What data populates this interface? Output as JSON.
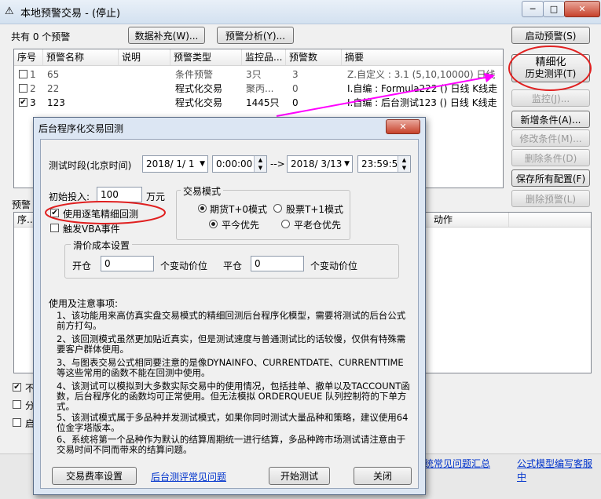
{
  "window": {
    "title": "本地预警交易 - (停止)",
    "caption_min": "─",
    "caption_max": "□",
    "caption_close": "✕"
  },
  "toolbar": {
    "count_label": "共有 0 个预警",
    "data_supplement": "数据补充(W)...",
    "alert_analysis": "预警分析(Y)...",
    "start_alert": "启动预警(S)"
  },
  "table": {
    "headers": [
      "序号",
      "预警名称",
      "说明",
      "预警类型",
      "监控品...",
      "预警数",
      "摘要"
    ],
    "rows": [
      {
        "checked": false,
        "no": "1",
        "name": "65",
        "desc": "",
        "type": "条件预警",
        "monitor": "3只",
        "count": "3",
        "summary": "Z.自定义 : 3.1 (5,10,10000) 日线"
      },
      {
        "checked": false,
        "no": "2",
        "name": "22",
        "desc": "",
        "type": "程式化交易",
        "monitor": "聚丙...",
        "count": "0",
        "summary": "I.自编 : Formula222 () 日线 K线走"
      },
      {
        "checked": true,
        "no": "3",
        "name": "123",
        "desc": "",
        "type": "程式化交易",
        "monitor": "1445只",
        "count": "0",
        "summary": "I.自编 : 后台测试123 () 日线 K线走"
      }
    ]
  },
  "side_buttons": {
    "fine_backtest_line1": "精细化",
    "fine_backtest_line2": "历史测评(T)",
    "monitor": "监控(J)...",
    "add_condition": "新增条件(A)...",
    "modify_condition": "修改条件(M)...",
    "delete_condition": "删除条件(D)",
    "save_all": "保存所有配置(F)",
    "delete_alert": "删除预警(L)"
  },
  "lower": {
    "panel_label": "预警",
    "col_seq": "序...",
    "col_action": "动作",
    "chk1_label": "不",
    "chk2_label": "分",
    "chk3_label": "启"
  },
  "bottom_links": {
    "faq": "统常见问题汇总",
    "formula_service": "公式模型编写客服中"
  },
  "dialog": {
    "title": "后台程序化交易回测",
    "close": "✕",
    "period_label": "测试时段(北京时间)",
    "start_date": "2018/ 1/ 1",
    "start_time": "0:00:00",
    "arrow": "-->",
    "end_date": "2018/ 3/13",
    "end_time": "23:59:59",
    "initial_label": "初始投入:",
    "initial_value": "100",
    "initial_unit": "万元",
    "fine_backtest_label": "使用逐笔精细回测",
    "fine_backtest_checked": true,
    "vba_label": "触发VBA事件",
    "vba_checked": false,
    "trade_mode_label": "交易模式",
    "mode_futures": "期货T+0模式",
    "mode_stock": "股票T+1模式",
    "close_today": "平今优先",
    "close_yesterday": "平老仓优先",
    "slippage_label": "滑价成本设置",
    "open_label": "开仓",
    "open_value": "0",
    "open_unit": "个变动价位",
    "close_label": "平仓",
    "close_value": "0",
    "close_unit": "个变动价位",
    "notes_title": "使用及注意事项:",
    "notes": [
      "1、该功能用来高仿真实盘交易模式的精细回测后台程序化模型，需要将测试的后台公式前方打勾。",
      "2、该回测模式虽然更加贴近真实，但是测试速度与普通测试比的话较慢，仅供有特殊需要客户群体使用。",
      "3、与图表交易公式相同要注意的是像DYNAINFO、CURRENTDATE、CURRENTTIME等这些常用的函数不能在回测中使用。",
      "4、该测试可以模拟到大多数实际交易中的使用情况，包括挂单、撤单以及TACCOUNT函数，后台程序化的函数均可正常使用。但无法模拟 ORDERQUEUE 队列控制符的下单方式。",
      "5、该测试模式属于多品种并发测试模式，如果你同时测试大量品种和策略，建议使用64位金字塔版本。",
      "6、系统将第一个品种作为默认的结算周期统一进行结算，多品种跨市场测试请注意由于交易时间不同而带来的结算问题。"
    ],
    "fee_button": "交易费率设置",
    "faq_link": "后台测评常见问题",
    "start_button": "开始测试",
    "close_button": "关闭"
  },
  "colors": {
    "highlight_ellipse": "#e02020",
    "arrow": "#ff00ff",
    "link": "#0033cc"
  }
}
